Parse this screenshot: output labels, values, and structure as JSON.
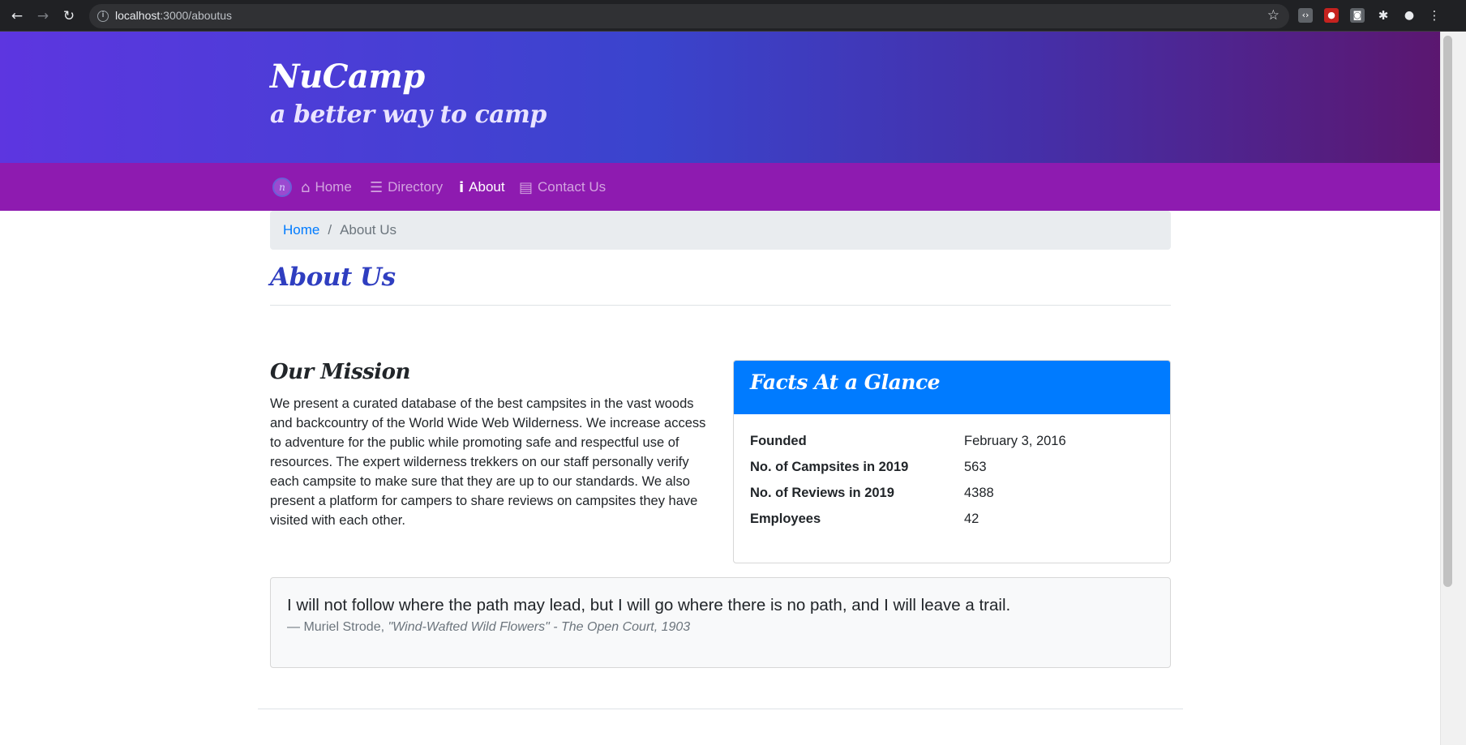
{
  "browser": {
    "url_host": "localhost",
    "url_path": ":3000/aboutus"
  },
  "header": {
    "brand": "NuCamp",
    "tagline": "a better way to camp"
  },
  "navbar": {
    "items": [
      {
        "label": "Home",
        "icon": "home-icon",
        "active": false
      },
      {
        "label": "Directory",
        "icon": "list-icon",
        "active": false
      },
      {
        "label": "About",
        "icon": "info-icon",
        "active": true
      },
      {
        "label": "Contact Us",
        "icon": "address-card-icon",
        "active": false
      }
    ]
  },
  "breadcrumb": {
    "home": "Home",
    "separator": "/",
    "current": "About Us"
  },
  "page": {
    "title": "About Us"
  },
  "mission": {
    "title": "Our Mission",
    "text": "We present a curated database of the best campsites in the vast woods and backcountry of the World Wide Web Wilderness. We increase access to adventure for the public while promoting safe and respectful use of resources. The expert wilderness trekkers on our staff personally verify each campsite to make sure that they are up to our standards. We also present a platform for campers to share reviews on campsites they have visited with each other."
  },
  "facts": {
    "title": "Facts At a Glance",
    "rows": [
      {
        "label": "Founded",
        "value": "February 3, 2016"
      },
      {
        "label": "No. of Campsites in 2019",
        "value": "563"
      },
      {
        "label": "No. of Reviews in 2019",
        "value": "4388"
      },
      {
        "label": "Employees",
        "value": "42"
      }
    ]
  },
  "quote": {
    "text": "I will not follow where the path may lead, but I will go where there is no path, and I will leave a trail.",
    "author": "— Muriel Strode,",
    "source": "\"Wind-Wafted Wild Flowers\" - The Open Court, 1903"
  },
  "colors": {
    "jumbotron_start": "#5d36e0",
    "jumbotron_end": "#5b1770",
    "navbar": "#8e1bb0",
    "link": "#007bff",
    "card_header": "#007bff",
    "title": "#2f3ec0"
  }
}
